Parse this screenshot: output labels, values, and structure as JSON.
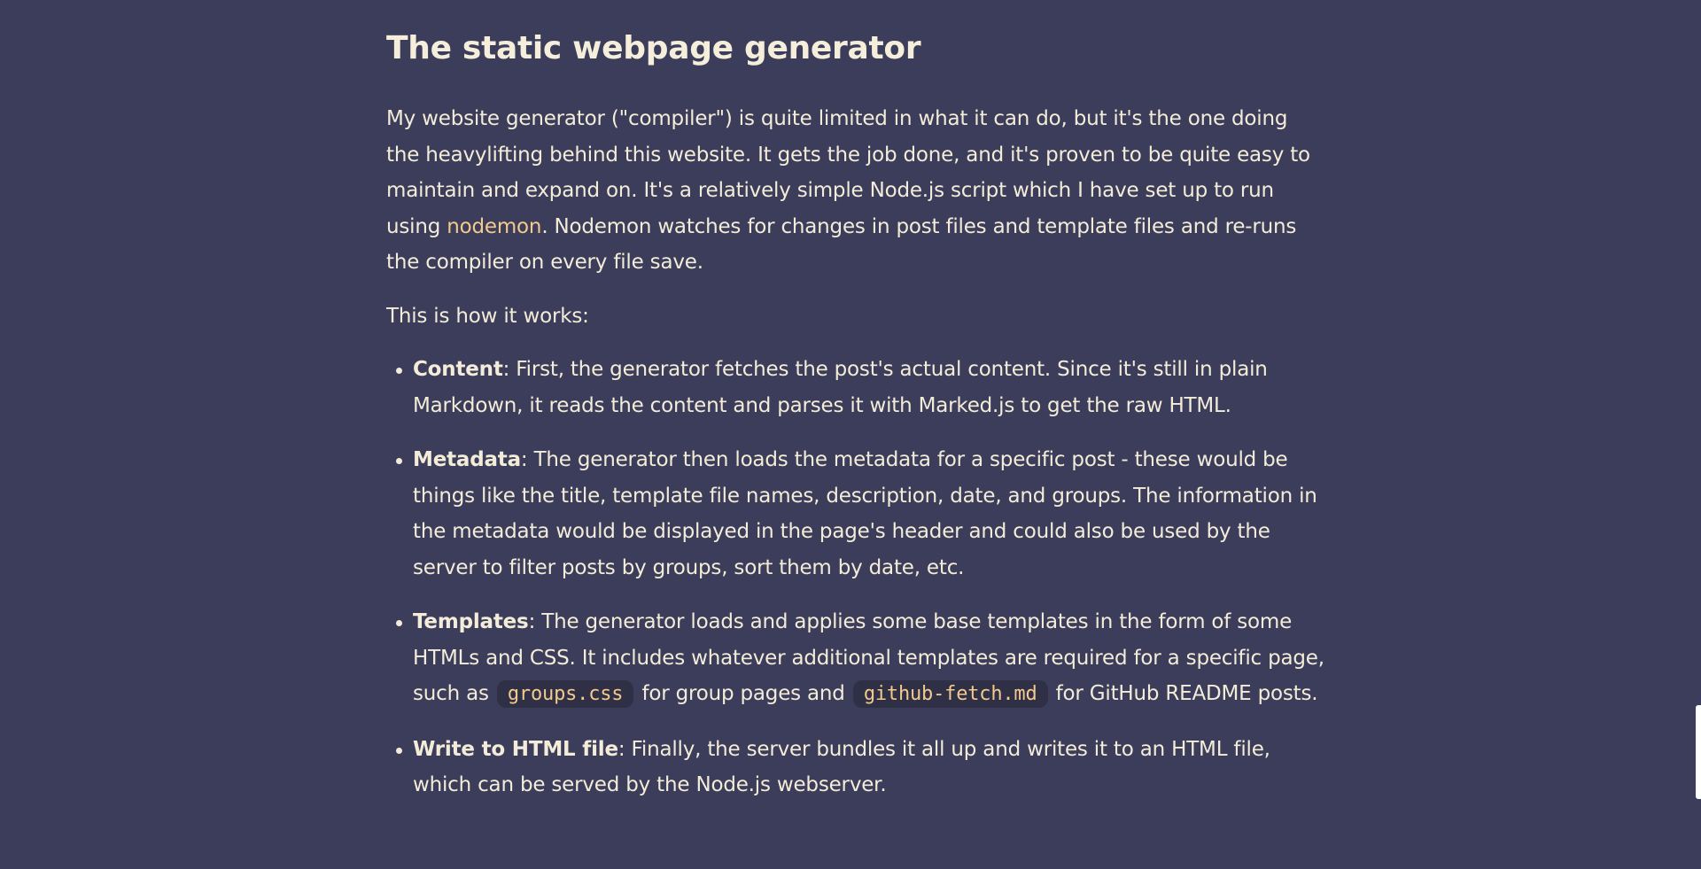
{
  "article": {
    "heading": "The static webpage generator",
    "intro": {
      "part1": "My website generator (\"compiler\") is quite limited in what it can do, but it's the one doing the heavylifting behind this website. It gets the job done, and it's proven to be quite easy to maintain and expand on. It's a relatively simple Node.js script which I have set up to run using ",
      "link_text": "nodemon",
      "part2": ". Nodemon watches for changes in post files and template files and re-runs the compiler on every file save."
    },
    "how_it_works": "This is how it works:",
    "steps": [
      {
        "title": "Content",
        "text": ": First, the generator fetches the post's actual content. Since it's still in plain Markdown, it reads the content and parses it with Marked.js to get the raw HTML."
      },
      {
        "title": "Metadata",
        "text": ": The generator then loads the metadata for a specific post - these would be things like the title, template file names, description, date, and groups. The information in the metadata would be displayed in the page's header and could also be used by the server to filter posts by groups, sort them by date, etc."
      },
      {
        "title": "Templates",
        "text_a": ": The generator loads and applies some base templates in the form of some HTMLs and CSS. It includes whatever additional templates are required for a specific page, such as ",
        "code_a": "groups.css",
        "text_b": " for group pages and ",
        "code_b": "github-fetch.md",
        "text_c": " for GitHub README posts."
      },
      {
        "title": "Write to HTML file",
        "text": ": Finally, the server bundles it all up and writes it to an HTML file, which can be served by the Node.js webserver."
      }
    ]
  },
  "colors": {
    "background": "#3c3d5a",
    "text": "#f3ecd9",
    "accent": "#f2c98e",
    "code_background": "#2f3045"
  }
}
